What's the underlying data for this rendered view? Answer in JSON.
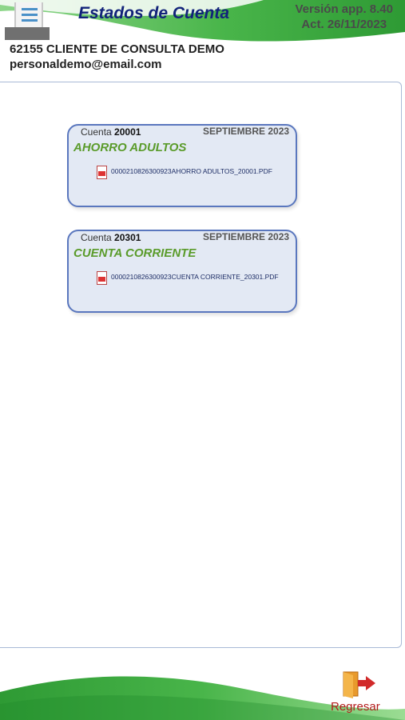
{
  "header": {
    "title": "Estados de Cuenta",
    "version_line1": "Versión app. 8.40",
    "version_line2": "Act. 26/11/2023",
    "menu_icon": "hamburger-menu-icon"
  },
  "client": {
    "name": "62155 CLIENTE DE CONSULTA DEMO",
    "email": "personaldemo@email.com"
  },
  "accounts": [
    {
      "account_label": "Cuenta",
      "account_number": "20001",
      "period": "SEPTIEMBRE 2023",
      "type": "AHORRO ADULTOS",
      "file": "0000210826300923AHORRO ADULTOS_20001.PDF"
    },
    {
      "account_label": "Cuenta",
      "account_number": "20301",
      "period": "SEPTIEMBRE 2023",
      "type": "CUENTA CORRIENTE",
      "file": "0000210826300923CUENTA CORRIENTE_20301.PDF"
    }
  ],
  "footer": {
    "back_label": "Regresar",
    "back_icon": "exit-door-icon"
  },
  "colors": {
    "brand_green": "#3fae3a",
    "title_blue": "#12237a",
    "card_border": "#5a77be",
    "card_bg": "#e3e9f4",
    "account_type_green": "#5a9b2a",
    "back_red": "#b31b1b"
  }
}
